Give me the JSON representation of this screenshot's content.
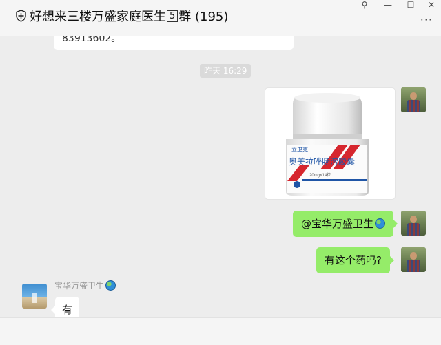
{
  "header": {
    "title": "好想来三楼万盛家庭医生",
    "badge": "5",
    "suffix": "群 (195)",
    "window_controls": [
      "⚲",
      "—",
      "☐",
      "✕"
    ],
    "more": "···"
  },
  "messages": {
    "prev_text": "83913602。",
    "timestamp": "昨天 16:29",
    "image": {
      "brand": "立卫克",
      "drug_name": "奥美拉唑肠溶胶囊",
      "spec": "20mg×14粒"
    },
    "mention": "@宝华万盛卫生",
    "question": "有这个药吗?",
    "sender_name": "宝华万盛卫生",
    "reply": "有"
  },
  "colors": {
    "sent_bubble": "#95ec69",
    "received_bubble": "#ffffff",
    "background": "#ededed"
  }
}
